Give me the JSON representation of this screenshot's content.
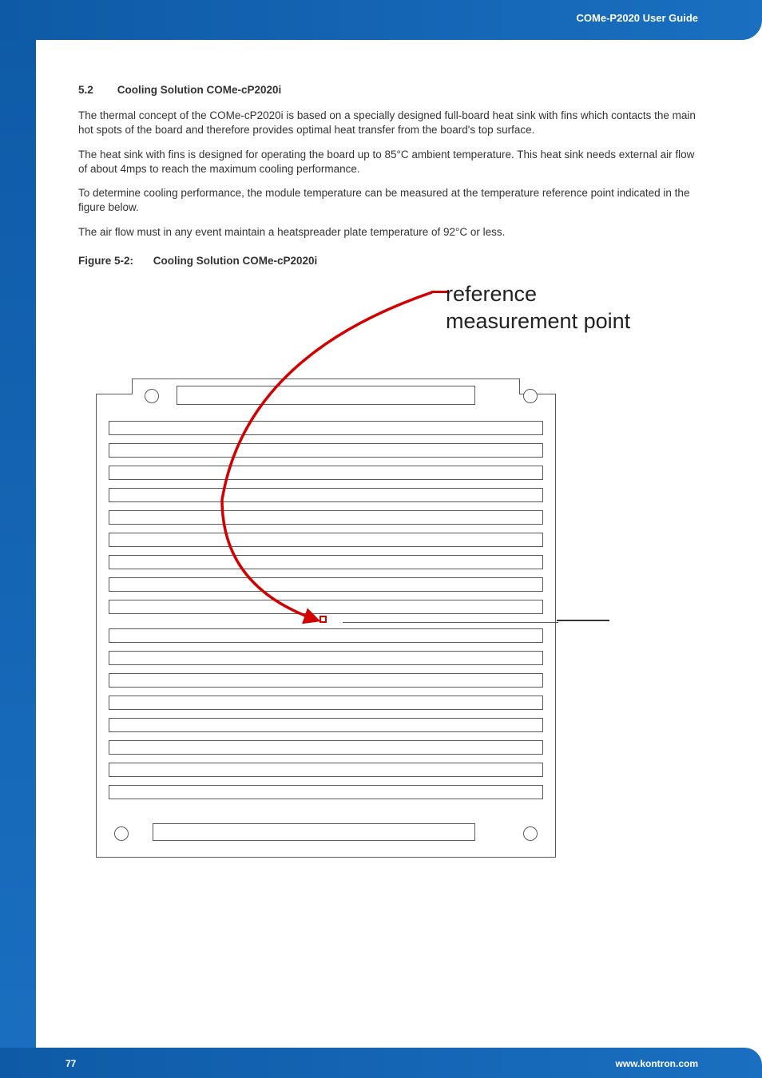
{
  "header": {
    "guide_title": "COMe-P2020 User Guide"
  },
  "section": {
    "number": "5.2",
    "title": "Cooling Solution COMe-cP2020i",
    "para1": "The thermal concept of the COMe-cP2020i is based on a specially designed full-board heat sink with fins which contacts the main hot spots of the board and therefore provides optimal heat transfer from the board's top surface.",
    "para2": "The heat sink with fins is designed for operating the board up to 85°C ambient temperature. This heat sink needs external air flow of about 4mps  to reach the maximum cooling performance.",
    "para3": "To determine cooling performance, the module temperature can be measured at the temperature reference point indicated in the figure below.",
    "para4": "The air flow must in any event maintain a heatspreader plate temperature of 92°C or less."
  },
  "figure": {
    "label": "Figure 5-2:",
    "caption": "Cooling Solution COMe-cP2020i",
    "annotation": "reference measurement point"
  },
  "footer": {
    "page": "77",
    "url": "www.kontron.com"
  }
}
